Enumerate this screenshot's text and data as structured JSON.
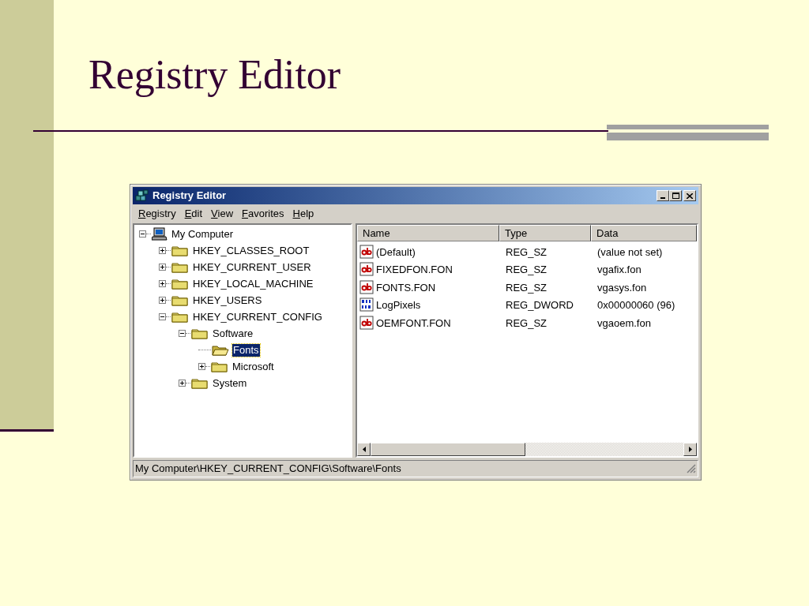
{
  "slide": {
    "title": "Registry Editor"
  },
  "window": {
    "title": "Registry Editor"
  },
  "menu": [
    "Registry",
    "Edit",
    "View",
    "Favorites",
    "Help"
  ],
  "tree": [
    {
      "label": "My Computer",
      "expanded": true,
      "selected": false,
      "children": [
        {
          "label": "HKEY_CLASSES_ROOT",
          "expanded": false,
          "selected": false
        },
        {
          "label": "HKEY_CURRENT_USER",
          "expanded": false,
          "selected": false
        },
        {
          "label": "HKEY_LOCAL_MACHINE",
          "expanded": false,
          "selected": false
        },
        {
          "label": "HKEY_USERS",
          "expanded": false,
          "selected": false
        },
        {
          "label": "HKEY_CURRENT_CONFIG",
          "expanded": true,
          "selected": false,
          "children": [
            {
              "label": "Software",
              "expanded": true,
              "selected": false,
              "children": [
                {
                  "label": "Fonts",
                  "selected": true
                },
                {
                  "label": "Microsoft",
                  "expanded": false,
                  "selected": false
                }
              ]
            },
            {
              "label": "System",
              "expanded": false,
              "selected": false
            }
          ]
        }
      ]
    }
  ],
  "table": {
    "columns": [
      "Name",
      "Type",
      "Data"
    ],
    "rows": [
      {
        "kind": "string",
        "name": "(Default)",
        "type": "REG_SZ",
        "data": "(value not set)"
      },
      {
        "kind": "string",
        "name": "FIXEDFON.FON",
        "type": "REG_SZ",
        "data": "vgafix.fon"
      },
      {
        "kind": "string",
        "name": "FONTS.FON",
        "type": "REG_SZ",
        "data": "vgasys.fon"
      },
      {
        "kind": "dword",
        "name": "LogPixels",
        "type": "REG_DWORD",
        "data": "0x00000060 (96)"
      },
      {
        "kind": "string",
        "name": "OEMFONT.FON",
        "type": "REG_SZ",
        "data": "vgaoem.fon"
      }
    ]
  },
  "status_bar": "My Computer\\HKEY_CURRENT_CONFIG\\Software\\Fonts"
}
